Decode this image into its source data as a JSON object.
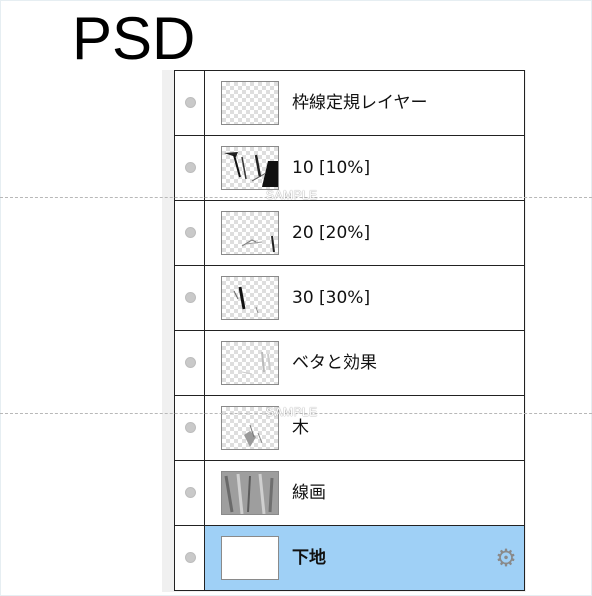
{
  "title": "PSD",
  "watermark": "SAMPLE",
  "layers": [
    {
      "name": "枠線定規レイヤー",
      "visible": true,
      "selected": false,
      "thumb": "transparent"
    },
    {
      "name": "10 [10%]",
      "visible": true,
      "selected": false,
      "thumb": "sketch-dark"
    },
    {
      "name": "20 [20%]",
      "visible": true,
      "selected": false,
      "thumb": "sketch-light"
    },
    {
      "name": "30 [30%]",
      "visible": true,
      "selected": false,
      "thumb": "sketch-marks"
    },
    {
      "name": "ベタと効果",
      "visible": true,
      "selected": false,
      "thumb": "faint"
    },
    {
      "name": "木",
      "visible": true,
      "selected": false,
      "thumb": "tree"
    },
    {
      "name": "線画",
      "visible": true,
      "selected": false,
      "thumb": "lineart"
    },
    {
      "name": "下地",
      "visible": true,
      "selected": true,
      "thumb": "white",
      "icon": "gear-icon"
    }
  ],
  "colors": {
    "selected_row": "#9fd0f6",
    "border": "#222222",
    "panel_bg": "#f0f0f0"
  }
}
